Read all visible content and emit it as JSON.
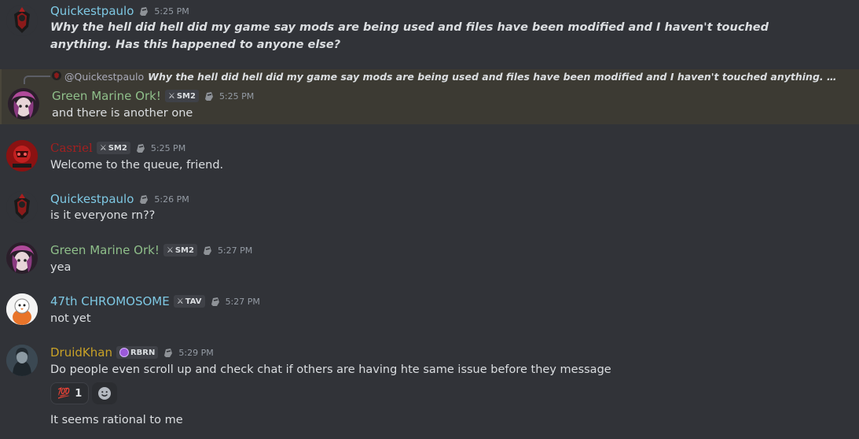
{
  "messages": [
    {
      "username": "Quickestpaulo",
      "time": "5:25 PM",
      "text": "Why the hell did hell did my game say mods are being used and files have been modified and I haven't touched anything. Has this happened to anyone else?"
    },
    {
      "reply_mention": "@Quickestpaulo",
      "reply_text": "Why the hell did hell did my game say mods are being used and files have been modified and I haven't touched anything. Has this happene...",
      "username": "Green Marine Ork!",
      "tag": "SM2",
      "time": "5:25 PM",
      "text": "and there is another one"
    },
    {
      "username": "Casriel",
      "tag": "SM2",
      "time": "5:25 PM",
      "text": "Welcome to the queue, friend."
    },
    {
      "username": "Quickestpaulo",
      "time": "5:26 PM",
      "text": "is it everyone rn??"
    },
    {
      "username": "Green Marine Ork!",
      "tag": "SM2",
      "time": "5:27 PM",
      "text": "yea"
    },
    {
      "username": "47th CHROMOSOME",
      "tag": "TAV",
      "time": "5:27 PM",
      "text": "not yet"
    },
    {
      "username": "DruidKhan",
      "tag": "RBRN",
      "time": "5:29 PM",
      "text": "Do people even scroll up and check chat if others are having hte same issue before they message",
      "reaction_emoji": "💯",
      "reaction_count": "1",
      "followup": "It seems rational to me"
    }
  ],
  "colors": {
    "quickestpaulo": "#7ec8e3",
    "green_marine": "#8fbf8a",
    "casriel": "#a32020",
    "chromosome": "#7ec8e3",
    "druidkhan": "#c9a227"
  }
}
